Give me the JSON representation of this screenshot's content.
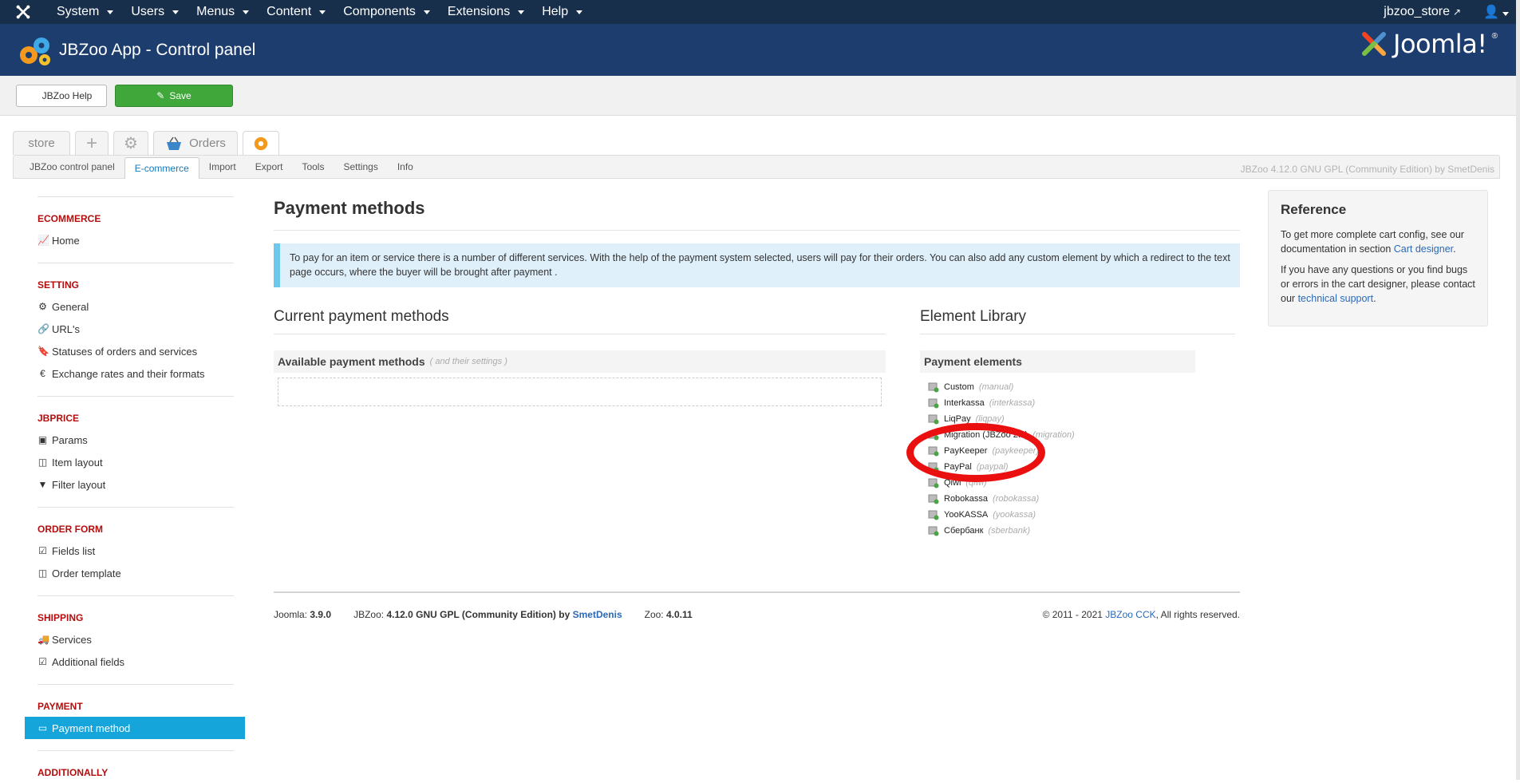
{
  "topbar": {
    "menus": [
      "System",
      "Users",
      "Menus",
      "Content",
      "Components",
      "Extensions",
      "Help"
    ],
    "site_link": "jbzoo_store"
  },
  "header": {
    "title": "JBZoo App - Control panel",
    "brand": "Joomla!"
  },
  "toolbar": {
    "help_label": "JBZoo Help",
    "save_label": "Save"
  },
  "app_tabs": {
    "store": "store",
    "orders": "Orders"
  },
  "subnav": {
    "items": [
      "JBZoo control panel",
      "E-commerce",
      "Import",
      "Export",
      "Tools",
      "Settings",
      "Info"
    ],
    "active": "E-commerce",
    "version": "JBZoo 4.12.0 GNU GPL (Community Edition) by SmetDenis"
  },
  "sidebar": {
    "sections": [
      {
        "title": "ECOMMERCE",
        "items": [
          {
            "icon": "chart-icon",
            "label": "Home"
          }
        ]
      },
      {
        "title": "SETTING",
        "items": [
          {
            "icon": "gear-icon",
            "label": "General"
          },
          {
            "icon": "link-icon",
            "label": "URL's"
          },
          {
            "icon": "bookmark-icon",
            "label": "Statuses of orders and services"
          },
          {
            "icon": "euro-icon",
            "label": "Exchange rates and their formats"
          }
        ]
      },
      {
        "title": "JBPRICE",
        "items": [
          {
            "icon": "money-icon",
            "label": "Params"
          },
          {
            "icon": "columns-icon",
            "label": "Item layout"
          },
          {
            "icon": "filter-icon",
            "label": "Filter layout"
          }
        ]
      },
      {
        "title": "ORDER FORM",
        "items": [
          {
            "icon": "check-icon",
            "label": "Fields list"
          },
          {
            "icon": "columns-icon",
            "label": "Order template"
          }
        ]
      },
      {
        "title": "SHIPPING",
        "items": [
          {
            "icon": "truck-icon",
            "label": "Services"
          },
          {
            "icon": "check-icon",
            "label": "Additional fields"
          }
        ]
      },
      {
        "title": "PAYMENT",
        "items": [
          {
            "icon": "card-icon",
            "label": "Payment method",
            "active": true
          }
        ]
      },
      {
        "title": "ADDITIONALLY",
        "items": []
      }
    ]
  },
  "main": {
    "title": "Payment methods",
    "info": "To pay for an item or service there is a number of different services. With the help of the payment system selected, users will pay for their orders. You can also add any custom element by which a redirect to the text page occurs, where the buyer will be brought after payment .",
    "current_title": "Current payment methods",
    "available_label": "Available payment methods",
    "available_hint": "( and their settings )",
    "library_title": "Element Library",
    "payment_elements_label": "Payment elements",
    "elements": [
      {
        "name": "Custom",
        "sys": "(manual)"
      },
      {
        "name": "Interkassa",
        "sys": "(interkassa)"
      },
      {
        "name": "LiqPay",
        "sys": "(liqpay)"
      },
      {
        "name": "Migration (JBZoo 2.x)",
        "sys": "(migration)"
      },
      {
        "name": "PayKeeper",
        "sys": "(paykeeper)"
      },
      {
        "name": "PayPal",
        "sys": "(paypal)"
      },
      {
        "name": "Qiwi",
        "sys": "(qiwi)"
      },
      {
        "name": "Robokassa",
        "sys": "(robokassa)"
      },
      {
        "name": "YooKASSA",
        "sys": "(yookassa)"
      },
      {
        "name": "Сбербанк",
        "sys": "(sberbank)"
      }
    ]
  },
  "reference": {
    "title": "Reference",
    "p1_text": "To get more complete cart config, see our documentation in section",
    "p1_link": "Cart designer",
    "p2_text": "If you have any questions or you find bugs or errors in the cart designer, please contact our",
    "p2_link": "technical support"
  },
  "footer": {
    "joomla_label": "Joomla:",
    "joomla_version": "3.9.0",
    "jbzoo_label": "JBZoo:",
    "jbzoo_version": "4.12.0 GNU GPL (Community Edition) by",
    "jbzoo_author": "SmetDenis",
    "zoo_label": "Zoo:",
    "zoo_version": "4.0.11",
    "copyright_pre": "© 2011 - 2021",
    "copyright_link": "JBZoo CCK",
    "copyright_post": ", All rights reserved."
  }
}
